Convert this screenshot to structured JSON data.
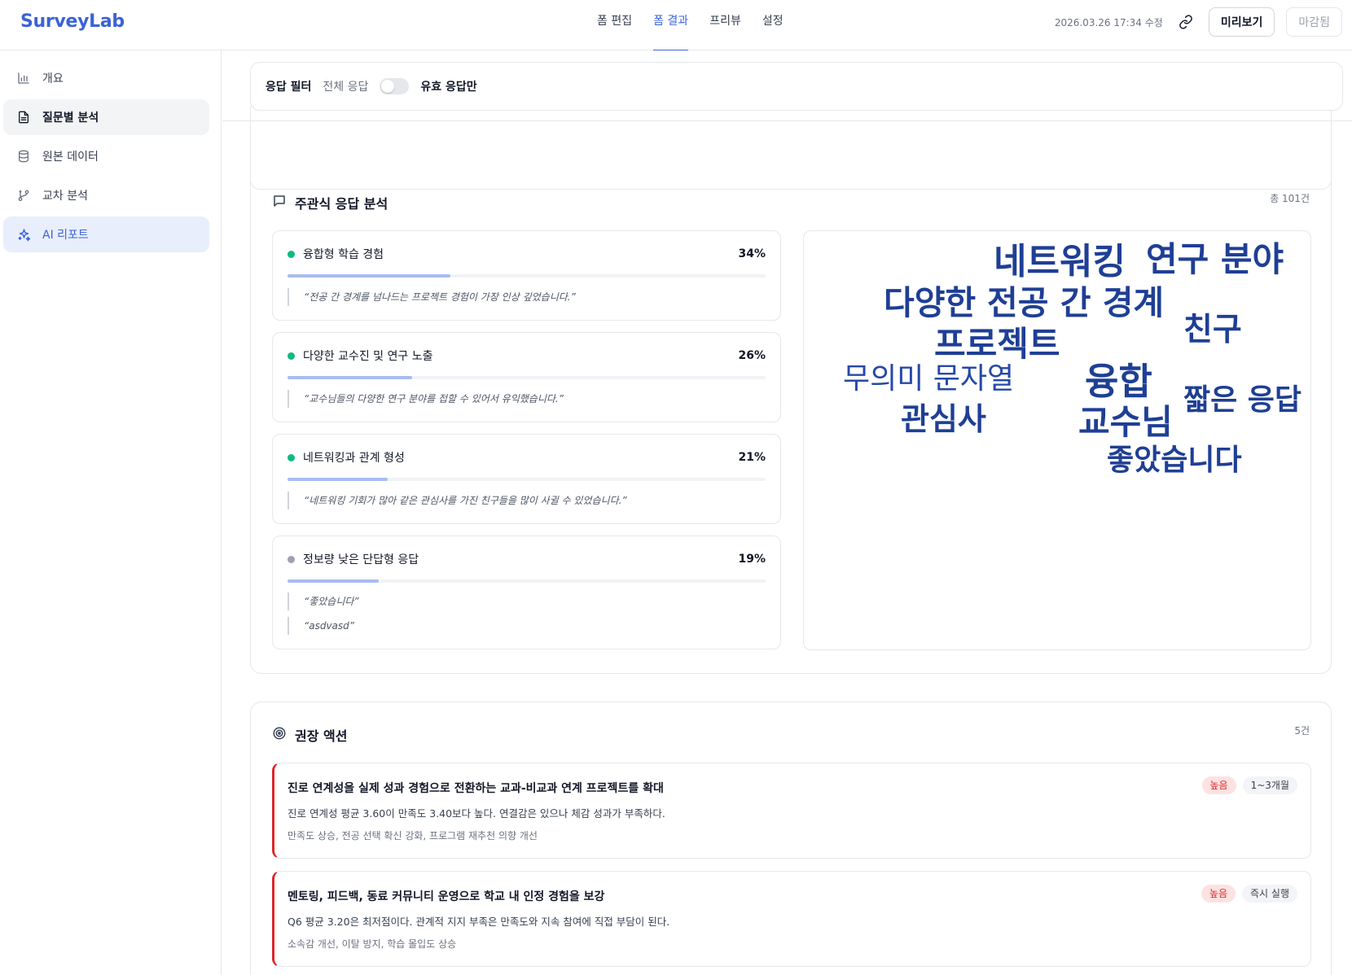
{
  "app": {
    "logo": "SurveyLab"
  },
  "nav": {
    "tabs": [
      {
        "label": "폼 편집"
      },
      {
        "label": "폼 결과"
      },
      {
        "label": "프리뷰"
      },
      {
        "label": "설정"
      }
    ]
  },
  "header": {
    "modified": "2026.03.26 17:34 수정",
    "preview_label": "미리보기",
    "closed_label": "마감됨"
  },
  "sidebar": {
    "items": [
      {
        "label": "개요"
      },
      {
        "label": "질문별 분석"
      },
      {
        "label": "원본 데이터"
      },
      {
        "label": "교차 분석"
      },
      {
        "label": "AI 리포트"
      }
    ]
  },
  "filter": {
    "label": "응답 필터",
    "all": "전체 응답",
    "valid_only": "유효 응답만",
    "valid_only_enabled": false
  },
  "open_ended": {
    "title": "주관식 응답 분석",
    "count": "총 101건",
    "themes": [
      {
        "name": "융합형 학습 경험",
        "pct": "34%",
        "value": 0.34,
        "quotes": [
          "“전공 간 경계를 넘나드는 프로젝트 경험이 가장 인상 깊었습니다.”"
        ]
      },
      {
        "name": "다양한 교수진 및 연구 노출",
        "pct": "26%",
        "value": 0.26,
        "quotes": [
          "“교수님들의 다양한 연구 분야를 접할 수 있어서 유익했습니다.”"
        ]
      },
      {
        "name": "네트워킹과 관계 형성",
        "pct": "21%",
        "value": 0.21,
        "quotes": [
          "“네트워킹 기회가 많아 같은 관심사를 가진 친구들을 많이 사귈 수 있었습니다.”"
        ]
      },
      {
        "name": "정보량 낮은 단답형 응답",
        "pct": "19%",
        "value": 0.19,
        "quotes": [
          "“좋았습니다”",
          "“asdvasd”"
        ]
      }
    ],
    "words": [
      "네트워킹",
      "연구 분야",
      "다양한",
      "전공 간 경계",
      "친구",
      "프로젝트",
      "무의미 문자열",
      "융합",
      "짧은 응답",
      "관심사",
      "교수님",
      "좋았습니다"
    ]
  },
  "actions": {
    "title": "권장 액션",
    "count": "5건",
    "items": [
      {
        "title": "진로 연계성을 실제 성과 경험으로 전환하는 교과-비교과 연계 프로젝트를 확대",
        "desc": "진로 연계성 평균 3.60이 만족도 3.40보다 높다. 연결감은 있으나 체감 성과가 부족하다.",
        "effect": "만족도 상승, 전공 선택 확신 강화, 프로그램 재추천 의향 개선",
        "priority": "높음",
        "timeline": "1~3개월"
      },
      {
        "title": "멘토링, 피드백, 동료 커뮤니티 운영으로 학교 내 인정 경험을 보강",
        "desc": "Q6 평균 3.20은 최저점이다. 관계적 지지 부족은 만족도와 지속 참여에 직접 부담이 된다.",
        "effect": "소속감 개선, 이탈 방지, 학습 몰입도 상승",
        "priority": "높음",
        "timeline": "즉시 실행"
      }
    ]
  }
}
